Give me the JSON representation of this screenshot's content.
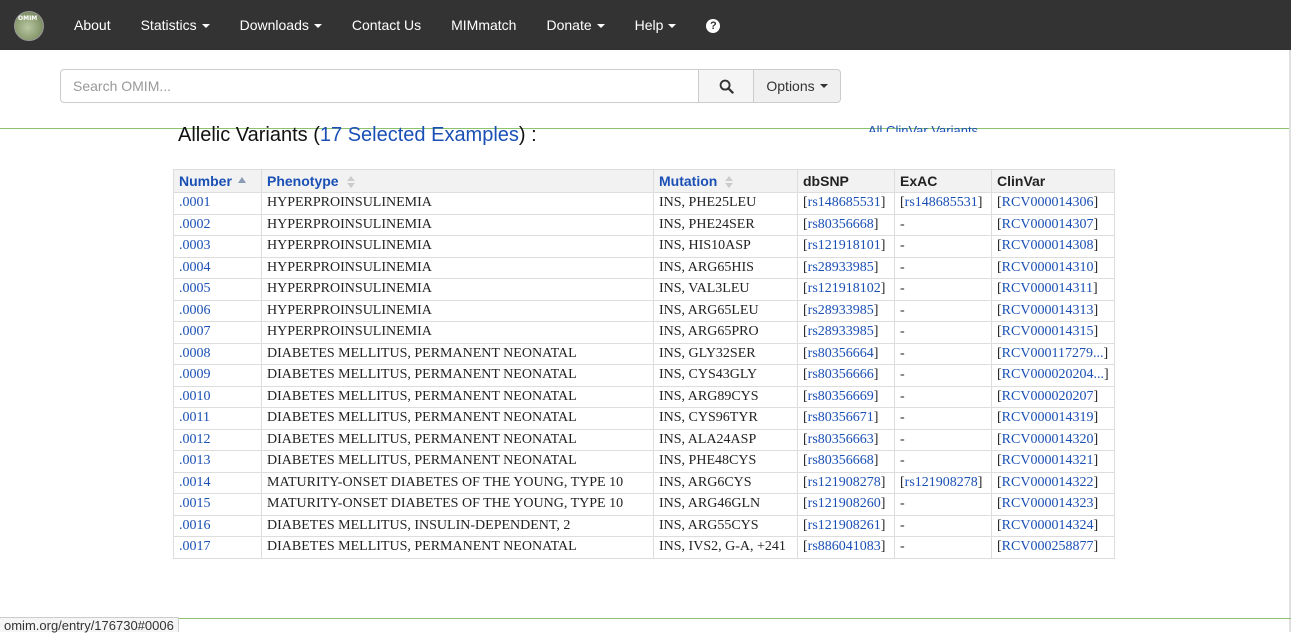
{
  "navbar": {
    "logo_text": "OMIM",
    "items": [
      {
        "label": "About",
        "dropdown": false
      },
      {
        "label": "Statistics",
        "dropdown": true
      },
      {
        "label": "Downloads",
        "dropdown": true
      },
      {
        "label": "Contact Us",
        "dropdown": false
      },
      {
        "label": "MIMmatch",
        "dropdown": false
      },
      {
        "label": "Donate",
        "dropdown": true
      },
      {
        "label": "Help",
        "dropdown": true
      }
    ],
    "help_icon": "?"
  },
  "search": {
    "placeholder": "Search OMIM...",
    "value": "",
    "options_label": "Options"
  },
  "allelic": {
    "heading_prefix": "Allelic Variants (",
    "heading_link": "17 Selected Examples",
    "heading_suffix": ") :",
    "clinvar_link": "All ClinVar Variants"
  },
  "table": {
    "headers": [
      "Number",
      "Phenotype",
      "Mutation",
      "dbSNP",
      "ExAC",
      "ClinVar"
    ],
    "rows": [
      {
        "number": ".0001",
        "phenotype": "HYPERPROINSULINEMIA",
        "mutation": "INS, PHE25LEU",
        "dbsnp": "rs148685531",
        "exac": "rs148685531",
        "clinvar": "RCV000014306"
      },
      {
        "number": ".0002",
        "phenotype": "HYPERPROINSULINEMIA",
        "mutation": "INS, PHE24SER",
        "dbsnp": "rs80356668",
        "exac": "-",
        "clinvar": "RCV000014307"
      },
      {
        "number": ".0003",
        "phenotype": "HYPERPROINSULINEMIA",
        "mutation": "INS, HIS10ASP",
        "dbsnp": "rs121918101",
        "exac": "-",
        "clinvar": "RCV000014308"
      },
      {
        "number": ".0004",
        "phenotype": "HYPERPROINSULINEMIA",
        "mutation": "INS, ARG65HIS",
        "dbsnp": "rs28933985",
        "exac": "-",
        "clinvar": "RCV000014310"
      },
      {
        "number": ".0005",
        "phenotype": "HYPERPROINSULINEMIA",
        "mutation": "INS, VAL3LEU",
        "dbsnp": "rs121918102",
        "exac": "-",
        "clinvar": "RCV000014311"
      },
      {
        "number": ".0006",
        "phenotype": "HYPERPROINSULINEMIA",
        "mutation": "INS, ARG65LEU",
        "dbsnp": "rs28933985",
        "exac": "-",
        "clinvar": "RCV000014313"
      },
      {
        "number": ".0007",
        "phenotype": "HYPERPROINSULINEMIA",
        "mutation": "INS, ARG65PRO",
        "dbsnp": "rs28933985",
        "exac": "-",
        "clinvar": "RCV000014315"
      },
      {
        "number": ".0008",
        "phenotype": "DIABETES MELLITUS, PERMANENT NEONATAL",
        "mutation": "INS, GLY32SER",
        "dbsnp": "rs80356664",
        "exac": "-",
        "clinvar": "RCV000117279..."
      },
      {
        "number": ".0009",
        "phenotype": "DIABETES MELLITUS, PERMANENT NEONATAL",
        "mutation": "INS, CYS43GLY",
        "dbsnp": "rs80356666",
        "exac": "-",
        "clinvar": "RCV000020204..."
      },
      {
        "number": ".0010",
        "phenotype": "DIABETES MELLITUS, PERMANENT NEONATAL",
        "mutation": "INS, ARG89CYS",
        "dbsnp": "rs80356669",
        "exac": "-",
        "clinvar": "RCV000020207"
      },
      {
        "number": ".0011",
        "phenotype": "DIABETES MELLITUS, PERMANENT NEONATAL",
        "mutation": "INS, CYS96TYR",
        "dbsnp": "rs80356671",
        "exac": "-",
        "clinvar": "RCV000014319"
      },
      {
        "number": ".0012",
        "phenotype": "DIABETES MELLITUS, PERMANENT NEONATAL",
        "mutation": "INS, ALA24ASP",
        "dbsnp": "rs80356663",
        "exac": "-",
        "clinvar": "RCV000014320"
      },
      {
        "number": ".0013",
        "phenotype": "DIABETES MELLITUS, PERMANENT NEONATAL",
        "mutation": "INS, PHE48CYS",
        "dbsnp": "rs80356668",
        "exac": "-",
        "clinvar": "RCV000014321"
      },
      {
        "number": ".0014",
        "phenotype": "MATURITY-ONSET DIABETES OF THE YOUNG, TYPE 10",
        "mutation": "INS, ARG6CYS",
        "dbsnp": "rs121908278",
        "exac": "rs121908278",
        "clinvar": "RCV000014322"
      },
      {
        "number": ".0015",
        "phenotype": "MATURITY-ONSET DIABETES OF THE YOUNG, TYPE 10",
        "mutation": "INS, ARG46GLN",
        "dbsnp": "rs121908260",
        "exac": "-",
        "clinvar": "RCV000014323"
      },
      {
        "number": ".0016",
        "phenotype": "DIABETES MELLITUS, INSULIN-DEPENDENT, 2",
        "mutation": "INS, ARG55CYS",
        "dbsnp": "rs121908261",
        "exac": "-",
        "clinvar": "RCV000014324"
      },
      {
        "number": ".0017",
        "phenotype": "DIABETES MELLITUS, PERMANENT NEONATAL",
        "mutation": "INS, IVS2, G-A, +241",
        "dbsnp": "rs886041083",
        "exac": "-",
        "clinvar": "RCV000258877"
      }
    ]
  },
  "statusbar": {
    "url": "omim.org/entry/176730#0006"
  },
  "colors": {
    "navbar_bg": "#333333",
    "link": "#1a50b5",
    "divider_green": "#8dc26f"
  }
}
